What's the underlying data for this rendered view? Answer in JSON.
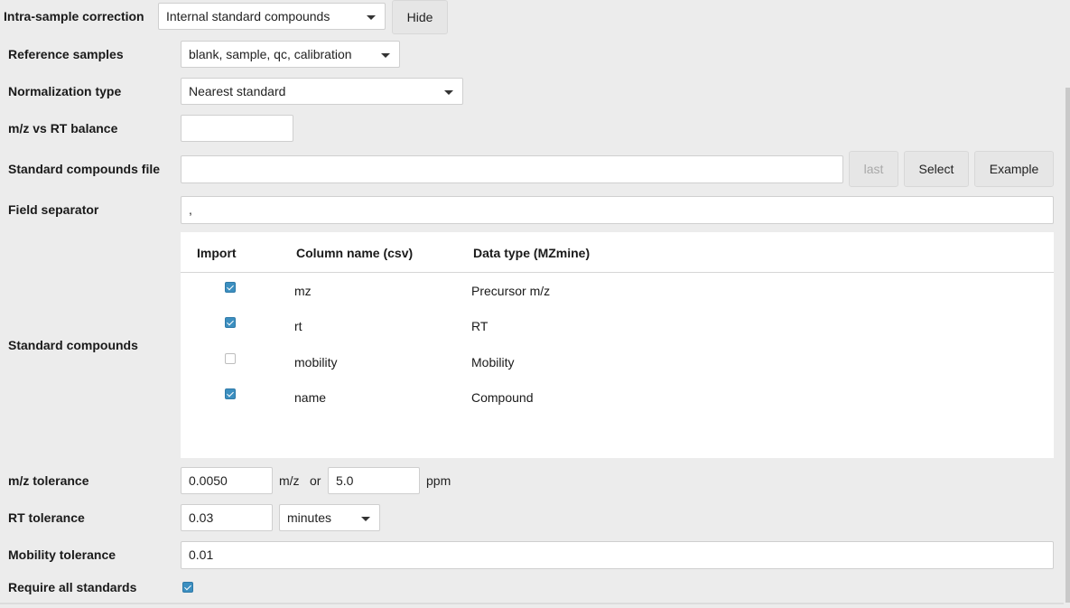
{
  "correction": {
    "label": "Intra-sample correction",
    "value": "Internal standard compounds",
    "hide_label": "Hide"
  },
  "reference_samples": {
    "label": "Reference samples",
    "value": "blank, sample, qc, calibration"
  },
  "normalization_type": {
    "label": "Normalization type",
    "value": "Nearest standard"
  },
  "mz_rt_balance": {
    "label": "m/z vs RT balance",
    "value": ""
  },
  "standards_file": {
    "label": "Standard compounds file",
    "value": "",
    "last_label": "last",
    "select_label": "Select",
    "example_label": "Example"
  },
  "field_separator": {
    "label": "Field separator",
    "value": ","
  },
  "standard_compounds": {
    "label": "Standard compounds",
    "headers": {
      "import": "Import",
      "column": "Column name (csv)",
      "type": "Data type (MZmine)"
    },
    "rows": [
      {
        "checked": true,
        "column": "mz",
        "type": "Precursor m/z"
      },
      {
        "checked": true,
        "column": "rt",
        "type": "RT"
      },
      {
        "checked": false,
        "column": "mobility",
        "type": "Mobility"
      },
      {
        "checked": true,
        "column": "name",
        "type": "Compound"
      }
    ]
  },
  "mz_tolerance": {
    "label": "m/z tolerance",
    "mz_value": "0.0050",
    "mz_unit": "m/z",
    "or": "or",
    "ppm_value": "5.0",
    "ppm_unit": "ppm"
  },
  "rt_tolerance": {
    "label": "RT tolerance",
    "value": "0.03",
    "unit": "minutes"
  },
  "mobility_tolerance": {
    "label": "Mobility tolerance",
    "value": "0.01"
  },
  "require_all": {
    "label": "Require all standards",
    "checked": true
  },
  "colors": {
    "accent": "#3c8fc0",
    "background": "#ececec"
  }
}
